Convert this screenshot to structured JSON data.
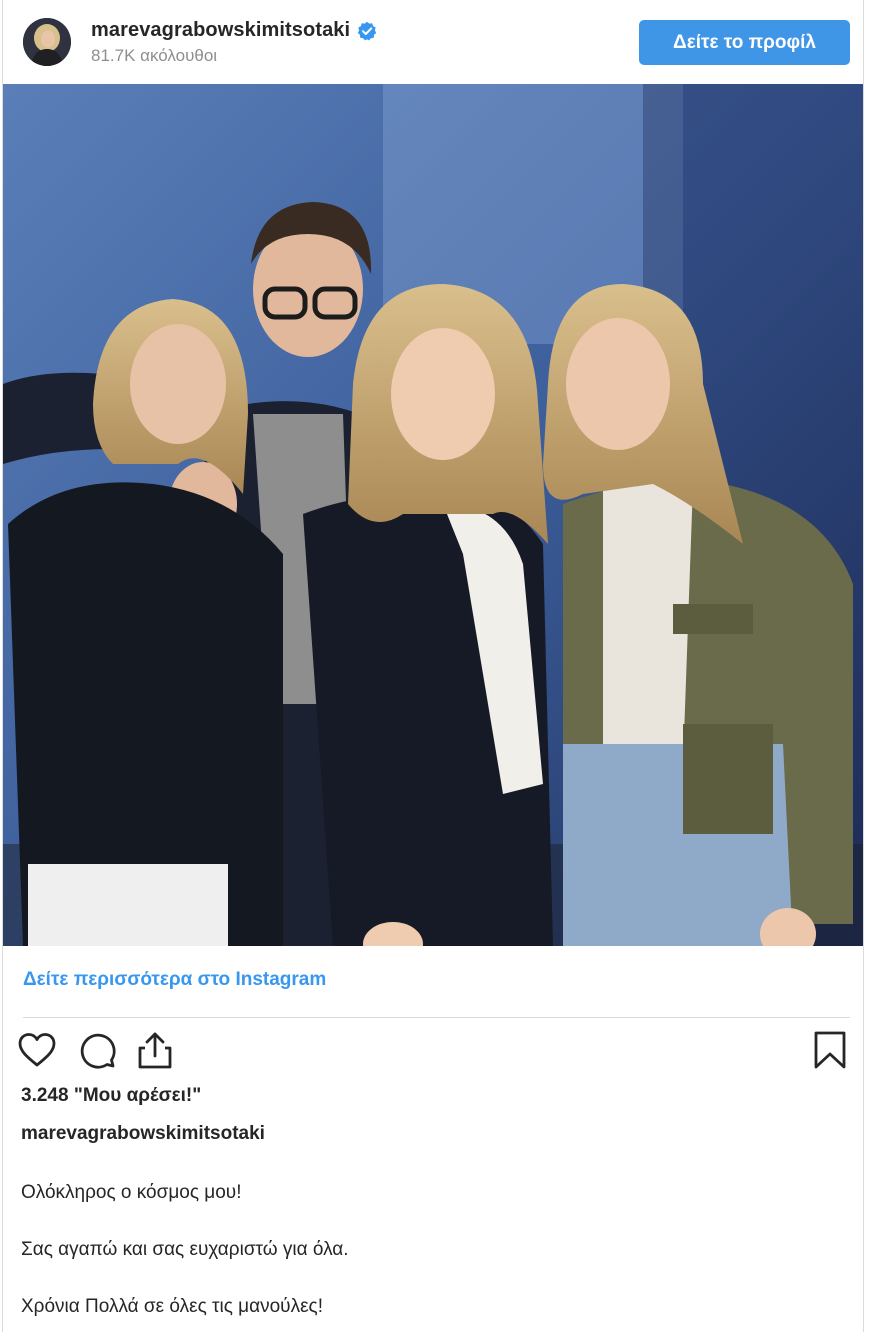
{
  "header": {
    "username": "marevagrabowskimitsotaki",
    "followers": "81.7K ακόλουθοι",
    "view_profile_label": "Δείτε το προφίλ"
  },
  "post": {
    "photo_icon": "photo",
    "see_more_label": "Δείτε περισσότερα στο Instagram",
    "likes": "3.248 \"Μου αρέσει!\"",
    "caption_username": "marevagrabowskimitsotaki",
    "caption_lines": [
      "Ολόκληρος ο κόσμος μου!",
      "Σας αγαπώ και σας ευχαριστώ για όλα.",
      "Χρόνια Πολλά σε όλες τις μανούλες!"
    ]
  },
  "icons": {
    "like": "heart-icon",
    "comment": "comment-icon",
    "share": "share-icon",
    "save": "bookmark-icon",
    "verified": "verified-badge-icon"
  },
  "colors": {
    "button_blue": "#4096e6",
    "link_blue": "#3897f0",
    "verified_blue": "#3897f0",
    "text": "#262626",
    "muted": "#8e8e8e"
  }
}
